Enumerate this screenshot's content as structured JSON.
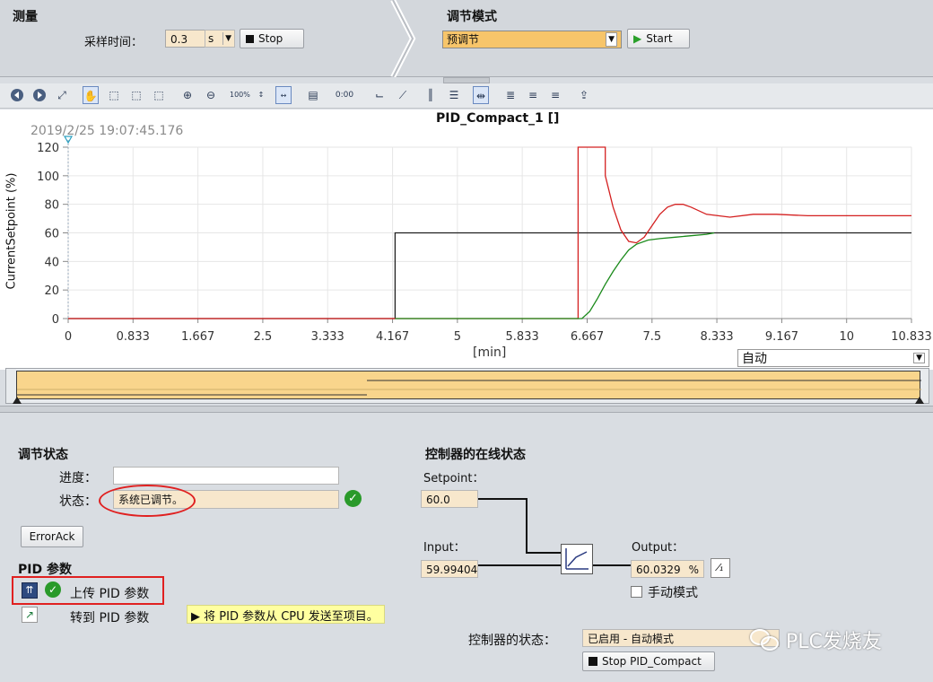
{
  "measure": {
    "title": "测量",
    "sample_label": "采样时间：",
    "sample_value": "0.3",
    "sample_unit": "s",
    "stop_label": "Stop"
  },
  "tuning_mode": {
    "title": "调节模式",
    "mode_value": "预调节",
    "start_label": "Start"
  },
  "toolbar": {
    "icons": [
      "back-icon",
      "forward-icon",
      "fit-icon",
      "pan-hand-icon",
      "zoom-area-icon",
      "zoom-x-icon",
      "zoom-y-icon",
      "zoom-in-icon",
      "zoom-out-icon",
      "zoom-100-icon",
      "zoom-y-100-icon",
      "zoom-x-100-icon",
      "chart-area-icon",
      "time-axis-icon",
      "line-icon",
      "line-diagonal-icon",
      "split-vertical-icon",
      "split-horizontal-icon",
      "cursor-icon",
      "legend-list-icon",
      "align-left-icon",
      "align-right-icon",
      "export-icon"
    ]
  },
  "chart_data": {
    "type": "line",
    "title": "PID_Compact_1 []",
    "timestamp": "2019/2/25 19:07:45.176",
    "ylabel": "CurrentSetpoint (%)",
    "xlabel": "[min]",
    "xlim": [
      0,
      10.833
    ],
    "ylim": [
      0,
      120
    ],
    "x_ticks": [
      "0",
      "0.833",
      "1.667",
      "2.5",
      "3.333",
      "4.167",
      "5",
      "5.833",
      "6.667",
      "7.5",
      "8.333",
      "9.167",
      "10",
      "10.833"
    ],
    "y_ticks": [
      "0",
      "20",
      "40",
      "60",
      "80",
      "100",
      "120"
    ],
    "series": [
      {
        "color": "#202020",
        "x": [
          0,
          4.2,
          4.2,
          10.833
        ],
        "values": [
          0,
          0,
          60,
          60
        ]
      },
      {
        "color": "#d42020",
        "x": [
          0,
          6.55,
          6.55,
          6.9,
          6.9,
          7.0,
          7.1,
          7.2,
          7.3,
          7.4,
          7.5,
          7.6,
          7.7,
          7.8,
          7.9,
          8.0,
          8.2,
          8.5,
          8.8,
          9.1,
          9.5,
          10.0,
          10.5,
          10.833
        ],
        "values": [
          0,
          0,
          120,
          120,
          100,
          78,
          62,
          54,
          53,
          57,
          65,
          73,
          78,
          80,
          80,
          78,
          73,
          71,
          73,
          73,
          72,
          72,
          72,
          72
        ]
      },
      {
        "color": "#1a8a1a",
        "x": [
          4.2,
          6.6,
          6.7,
          6.8,
          6.9,
          7.0,
          7.1,
          7.2,
          7.3,
          7.45,
          7.6,
          7.8,
          8.0,
          8.2,
          8.3
        ],
        "values": [
          0,
          0,
          5,
          14,
          24,
          33,
          41,
          48,
          52,
          55,
          56,
          57,
          58,
          59,
          60
        ]
      }
    ]
  },
  "axis_mode": "自动",
  "tuning_status": {
    "title": "调节状态",
    "progress_label": "进度：",
    "progress_value": "",
    "status_label": "状态：",
    "status_value": "系统已调节。",
    "error_ack_label": "ErrorAck"
  },
  "pid_params": {
    "title": "PID 参数",
    "upload_label": "上传 PID 参数",
    "goto_label": "转到 PID 参数",
    "tooltip": "将 PID 参数从 CPU 发送至项目。"
  },
  "online_status": {
    "title": "控制器的在线状态",
    "setpoint_label": "Setpoint：",
    "setpoint_value": "60.0",
    "input_label": "Input：",
    "input_value": "59.99404",
    "output_label": "Output：",
    "output_value": "60.0329",
    "output_unit": "%",
    "manual_label": "手动模式",
    "controller_state_label": "控制器的状态：",
    "controller_state_value": "已启用 - 自动模式",
    "stop_pid_label": "Stop PID_Compact"
  },
  "watermark": "PLC发烧友"
}
